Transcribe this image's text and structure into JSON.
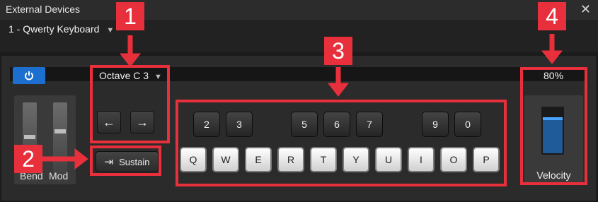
{
  "window": {
    "title": "External Devices"
  },
  "device": {
    "name": "1 - Qwerty Keyboard"
  },
  "wheels": {
    "bend_label": "Bend",
    "mod_label": "Mod"
  },
  "octave": {
    "label": "Octave C 3"
  },
  "octave_buttons": {
    "left": "←",
    "right": "→"
  },
  "sustain": {
    "label": "Sustain"
  },
  "keys": {
    "black": [
      "2",
      "3",
      "5",
      "6",
      "7",
      "9",
      "0"
    ],
    "white": [
      "Q",
      "W",
      "E",
      "R",
      "T",
      "Y",
      "U",
      "I",
      "O",
      "P"
    ]
  },
  "velocity": {
    "label": "Velocity",
    "value_text": "80%",
    "level": 0.8
  },
  "callouts": [
    "1",
    "2",
    "3",
    "4"
  ],
  "colors": {
    "accent": "#1c6fcf",
    "annotation": "#e8303c",
    "velocity_fill": "#1f5a99"
  }
}
